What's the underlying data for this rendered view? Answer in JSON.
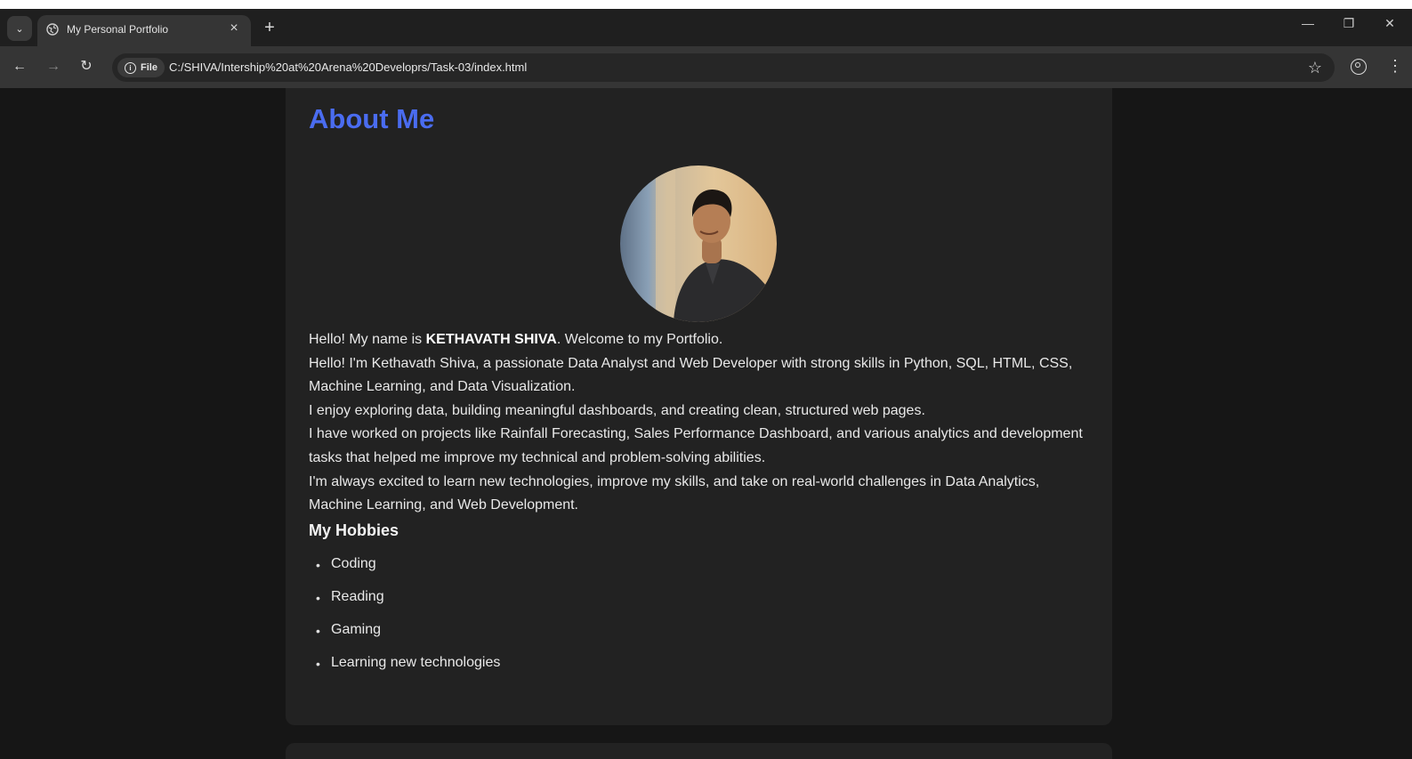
{
  "browser": {
    "tab_title": "My Personal Portfolio",
    "tab_close": "×",
    "new_tab": "+",
    "site_chip_label": "File",
    "url": "C:/SHIVA/Intership%20at%20Arena%20Developrs/Task-03/index.html"
  },
  "about": {
    "heading": "About Me",
    "intro_prefix": "Hello! My name is ",
    "intro_name": "KETHAVATH SHIVA",
    "intro_suffix": ". Welcome to my Portfolio.",
    "paragraphs": [
      "Hello! I'm Kethavath Shiva, a passionate Data Analyst and Web Developer with strong skills in Python, SQL, HTML, CSS, Machine Learning, and Data Visualization.",
      "I enjoy exploring data, building meaningful dashboards, and creating clean, structured web pages.",
      "I have worked on projects like Rainfall Forecasting, Sales Performance Dashboard, and various analytics and development tasks that helped me improve my technical and problem-solving abilities.",
      "I'm always excited to learn new technologies, improve my skills, and take on real-world challenges in Data Analytics, Machine Learning, and Web Development."
    ],
    "hobbies_title": "My Hobbies",
    "hobbies": [
      "Coding",
      "Reading",
      "Gaming",
      "Learning new technologies"
    ]
  },
  "colors": {
    "accent": "#4a6cf0",
    "card_bg": "#222222",
    "page_bg": "#161616"
  }
}
